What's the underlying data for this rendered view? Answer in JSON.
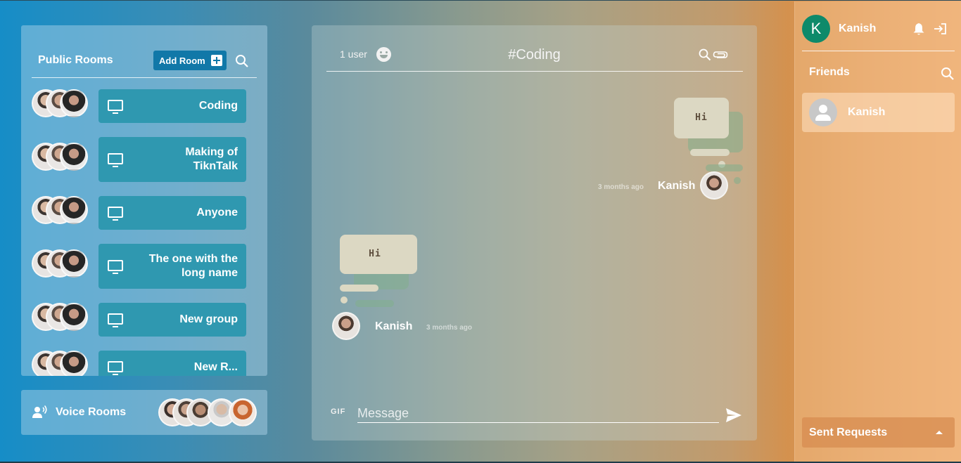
{
  "left": {
    "title": "Public Rooms",
    "add_room_label": "Add Room",
    "rooms": [
      {
        "name": "Coding"
      },
      {
        "name": "Making of TiknTalk",
        "line1": "Making of",
        "line2": "TiknTalk"
      },
      {
        "name": "Anyone"
      },
      {
        "name": "The one with the long name",
        "line1": "The one with the",
        "line2": "long name"
      },
      {
        "name": "New group"
      },
      {
        "name": "New R..."
      }
    ]
  },
  "voice": {
    "label": "Voice Rooms"
  },
  "chat": {
    "user_count": "1 user",
    "room_title": "#Coding",
    "messages": [
      {
        "text": "Hi",
        "author": "Kanish",
        "time": "3 months ago",
        "side": "right"
      },
      {
        "text": "Hi",
        "author": "Kanish",
        "time": "3 months ago",
        "side": "left"
      }
    ],
    "gif_label": "GIF",
    "input_placeholder": "Message",
    "input_value": ""
  },
  "sidebar": {
    "user_initial": "K",
    "user_name": "Kanish",
    "friends_title": "Friends",
    "friends": [
      {
        "name": "Kanish"
      }
    ],
    "sent_requests_label": "Sent Requests"
  },
  "colors": {
    "accent": "#1178a8",
    "room_button": "#2f98b0",
    "user_avatar": "#0e8a6a"
  },
  "icons": [
    "search-icon",
    "plus-icon",
    "monitor-icon",
    "voice-icon",
    "emoji-icon",
    "paperclip-icon",
    "send-icon",
    "bell-icon",
    "logout-icon",
    "person-icon",
    "caret-up-icon"
  ]
}
